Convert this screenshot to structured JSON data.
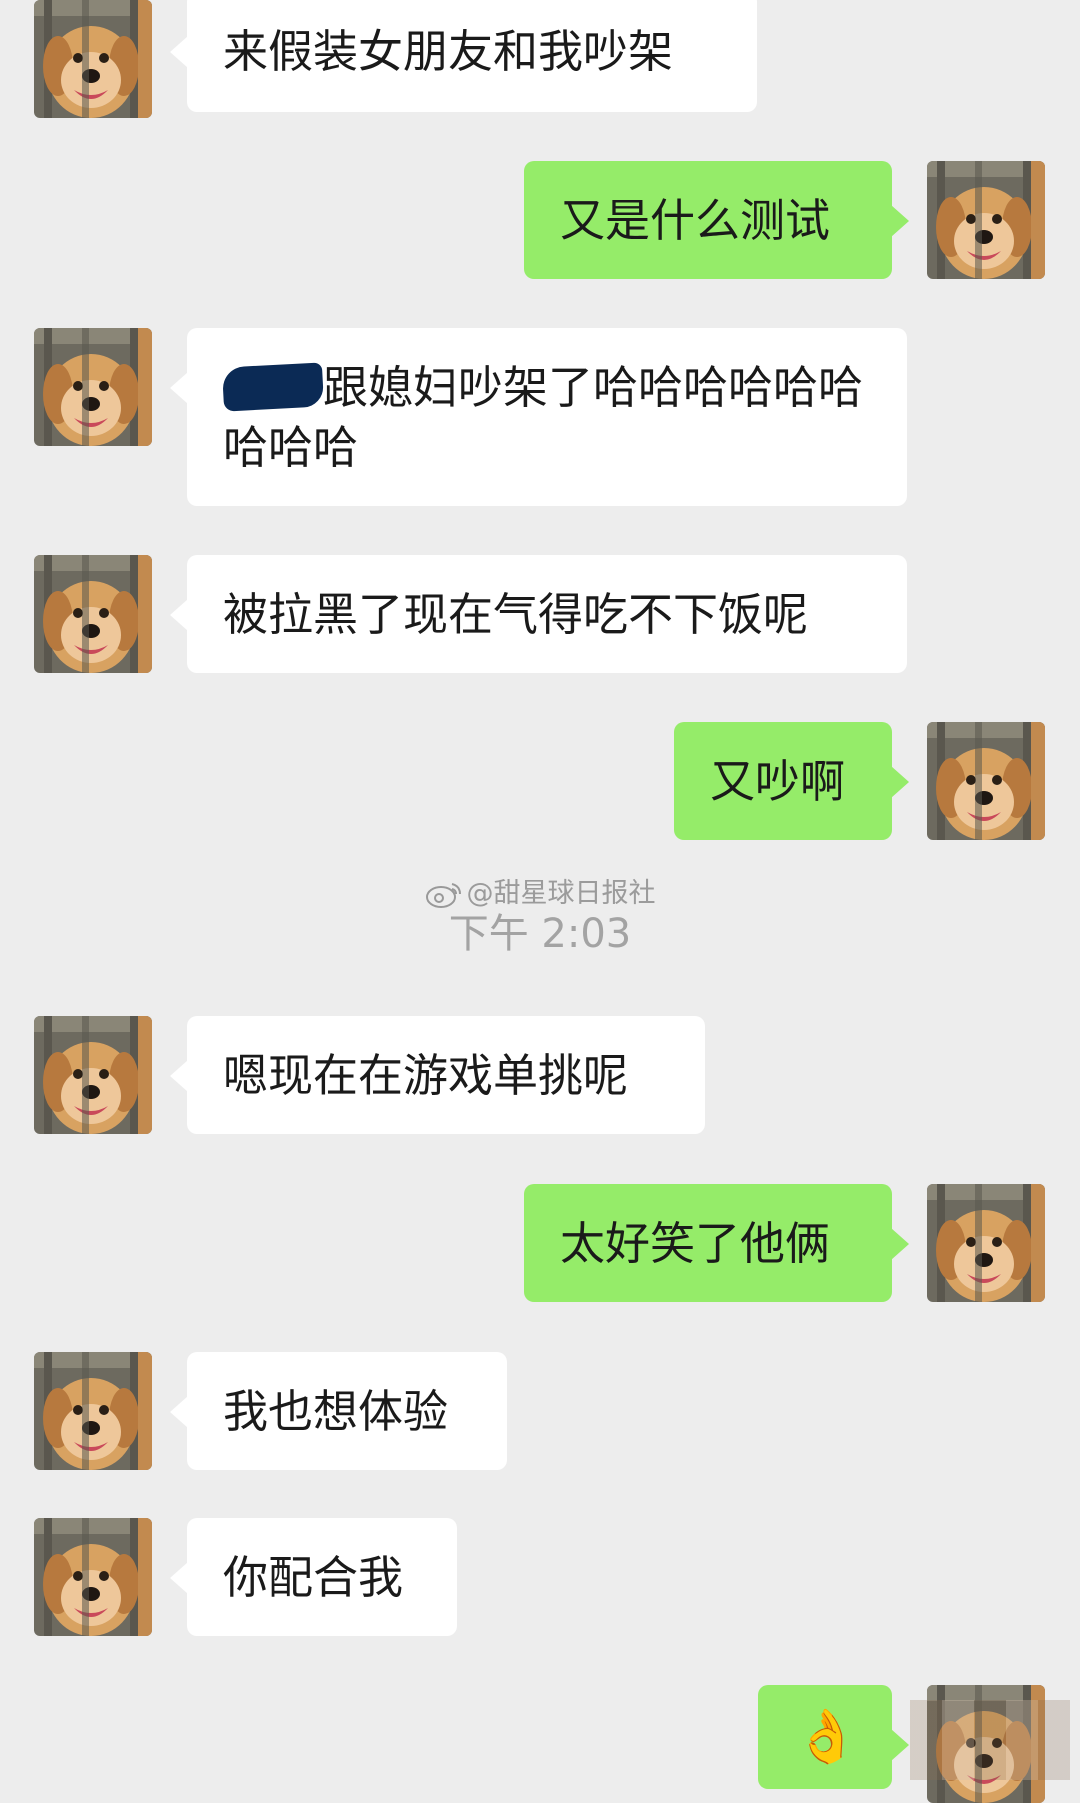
{
  "chat": {
    "messages": [
      {
        "side": "left",
        "text": "来假装女朋友和我吵架"
      },
      {
        "side": "right",
        "text": "又是什么测试"
      },
      {
        "side": "left",
        "text": "跟媳妇吵架了哈哈哈哈哈哈哈哈哈"
      },
      {
        "side": "left",
        "text": "被拉黑了现在气得吃不下饭呢"
      },
      {
        "side": "right",
        "text": "又吵啊"
      },
      {
        "side": "left",
        "text": "嗯现在在游戏单挑呢"
      },
      {
        "side": "right",
        "text": "太好笑了他俩"
      },
      {
        "side": "left",
        "text": "我也想体验"
      },
      {
        "side": "left",
        "text": "你配合我"
      },
      {
        "side": "right",
        "text": "👌",
        "icon": "ok-hand-emoji"
      }
    ],
    "timestamp": "下午 2:03",
    "watermark": "@甜星球日报社"
  },
  "colors": {
    "background": "#ededed",
    "incoming_bubble": "#ffffff",
    "outgoing_bubble": "#95ec69",
    "timestamp_text": "#a3a3a3",
    "redaction": "#0b2a55"
  },
  "icons": {
    "avatar": "golden-retriever-avatar",
    "watermark_logo": "weibo-icon"
  }
}
